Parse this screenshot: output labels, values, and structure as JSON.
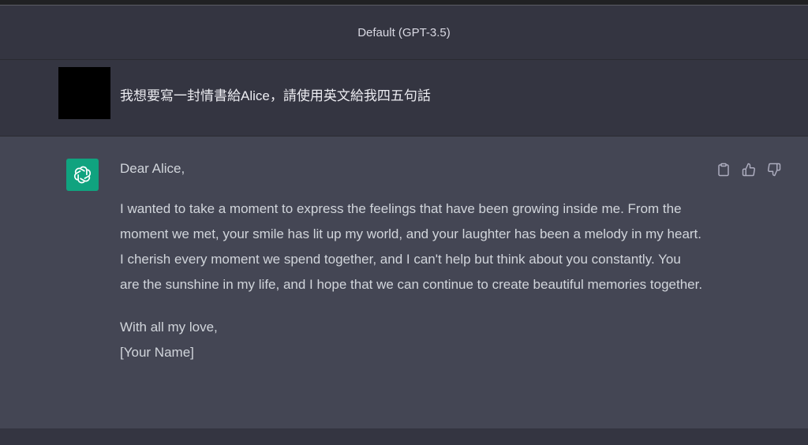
{
  "header": {
    "model_label": "Default (GPT-3.5)"
  },
  "conversation": {
    "user_message": "我想要寫一封情書給Alice，請使用英文給我四五句話",
    "assistant": {
      "greeting": "Dear Alice,",
      "body": "I wanted to take a moment to express the feelings that have been growing inside me. From the moment we met, your smile has lit up my world, and your laughter has been a melody in my heart. I cherish every moment we spend together, and I can't help but think about you constantly. You are the sunshine in my life, and I hope that we can continue to create beautiful memories together.",
      "closing": "With all my love,",
      "signature": "[Your Name]"
    }
  },
  "actions": {
    "icons": [
      "clipboard-icon",
      "thumbs-up-icon",
      "thumbs-down-icon"
    ]
  },
  "colors": {
    "background": "#343541",
    "assistant_background": "#444654",
    "bot_avatar": "#10a37f"
  }
}
